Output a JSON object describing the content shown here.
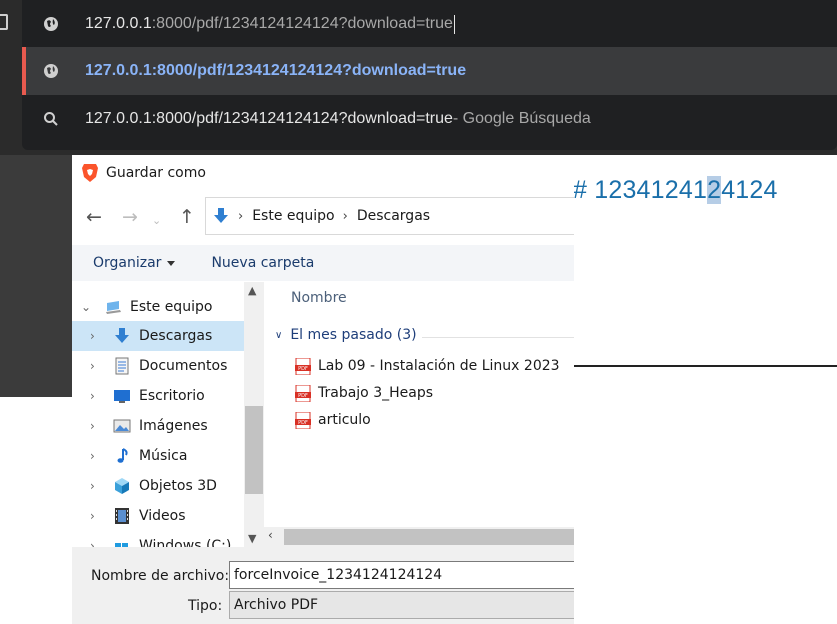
{
  "omnibox": {
    "input_host": "127.0.0.1",
    "input_path": ":8000/pdf/1234124124124?download=true",
    "suggestion_url": "127.0.0.1:8000/pdf/1234124124124?download=true",
    "search_query": "127.0.0.1:8000/pdf/1234124124124?download=true",
    "search_suffix": " - Google Búsqueda"
  },
  "page": {
    "hash_prefix": "# 1234124",
    "hash_mid": "1",
    "hash_highlight": "2",
    "hash_suffix": "4124"
  },
  "dialog": {
    "title": "Guardar como",
    "breadcrumb": [
      "Este equipo",
      "Descargas"
    ],
    "toolbar": {
      "organize": "Organizar",
      "new_folder": "Nueva carpeta"
    },
    "tree": [
      {
        "label": "Este equipo",
        "icon": "computer-icon"
      },
      {
        "label": "Descargas",
        "icon": "download-arrow-icon",
        "selected": true
      },
      {
        "label": "Documentos",
        "icon": "document-icon"
      },
      {
        "label": "Escritorio",
        "icon": "desktop-icon"
      },
      {
        "label": "Imágenes",
        "icon": "pictures-icon"
      },
      {
        "label": "Música",
        "icon": "music-icon"
      },
      {
        "label": "Objetos 3D",
        "icon": "cube-3d-icon"
      },
      {
        "label": "Videos",
        "icon": "video-icon"
      },
      {
        "label": "Windows (C:)",
        "icon": "drive-icon"
      }
    ],
    "column_header": "Nombre",
    "group": "El mes pasado (3)",
    "files": [
      "Lab 09 - Instalación de Linux 2023",
      "Trabajo 3_Heaps",
      "articulo"
    ],
    "filename_label": "Nombre de archivo:",
    "filename_value": "forceInvoice_1234124124124",
    "type_label": "Tipo:",
    "type_value": "Archivo PDF"
  },
  "colors": {
    "omnibox_bg": "#1f2022",
    "suggestion_link": "#8ab4f8",
    "accent_bar": "#e85a4f",
    "selection": "#cce5f7",
    "page_heading": "#1a6faa"
  }
}
